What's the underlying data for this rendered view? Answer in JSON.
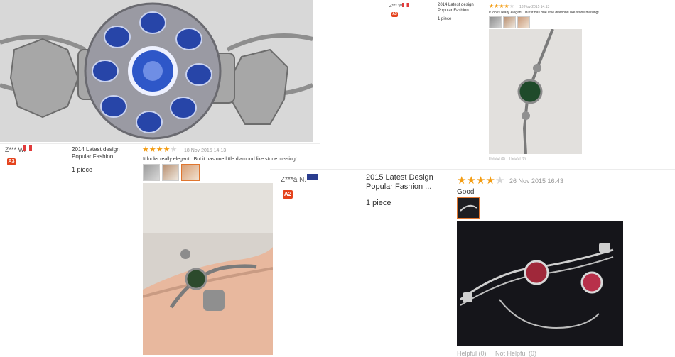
{
  "colors": {
    "star": "#f39c12",
    "star_off": "#d6d6d6",
    "badge": "#e4421c",
    "date": "#999999"
  },
  "reviews": [
    {
      "user": "Z*** W.",
      "badge": "A3",
      "product_line1": "2014 Latest design",
      "product_line2": "Popular Fashion ...",
      "qty": "1 piece",
      "date": "18 Nov 2015 14:13",
      "text": "It looks really elegant . But it has one little diamond like stone missing!",
      "rating": 4
    },
    {
      "user": "Z*** W.",
      "badge": "A3",
      "product_line1": "2014 Latest design",
      "product_line2": "Popular Fashion ...",
      "qty": "1 piece",
      "date": "18 Nov 2015 14:13",
      "text": "It looks really elegant . But it has one little diamond like stone missing!",
      "rating": 4,
      "helpful": "Helpful (0)",
      "not_helpful": "Helpful (0)"
    },
    {
      "user": "Z***a N.",
      "badge": "A2",
      "product_line1": "2015 Latest Design",
      "product_line2": "Popular Fashion ...",
      "qty": "1 piece",
      "date": "26 Nov 2015 16:43",
      "text": "Good",
      "rating": 4,
      "helpful": "Helpful (0)",
      "not_helpful": "Not Helpful (0)"
    }
  ]
}
